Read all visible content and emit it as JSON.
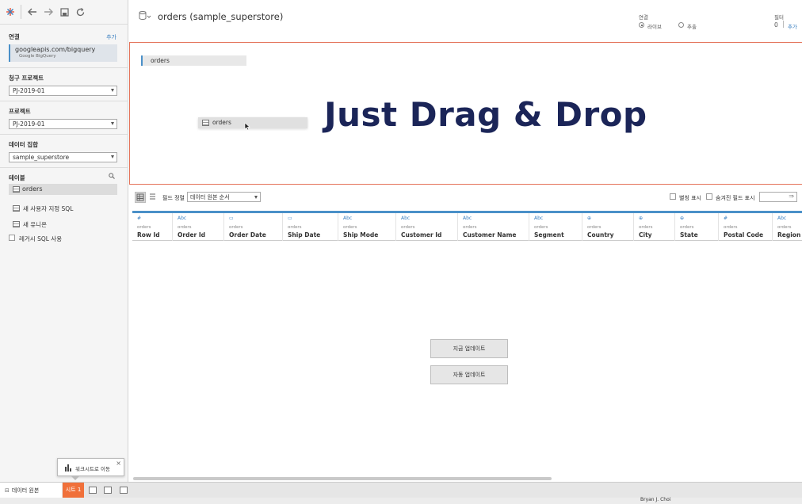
{
  "sidebar": {
    "connection_label": "연결",
    "connection_add": "추가",
    "connection_name": "googleapis.com/bigquery",
    "connection_type": "Google BigQuery",
    "billing_project_label": "청구 프로젝트",
    "billing_project_value": "PJ-2019-01",
    "project_label": "프로젝트",
    "project_value": "PJ-2019-01",
    "dataset_label": "데이터 집합",
    "dataset_value": "sample_superstore",
    "tables_label": "테이블",
    "table_item": "orders",
    "new_custom_sql": "새 사용자 지정 SQL",
    "new_union": "새 유니온",
    "legacy_sql": "레거시 SQL 사용"
  },
  "header": {
    "title": "orders (sample_superstore)",
    "connection_label": "연결",
    "live": "라이브",
    "extract": "추출",
    "filter_label": "필터",
    "filter_count": "0",
    "filter_add": "추가"
  },
  "canvas": {
    "table": "orders",
    "dragging_table": "orders",
    "overlay_text": "Just Drag & Drop"
  },
  "grid_toolbar": {
    "field_sort_label": "필드 정렬",
    "sort_value": "데이터 원본 순서",
    "show_alias": "별칭 표시",
    "show_hidden": "숨겨진 필드 표시"
  },
  "columns": [
    {
      "icon": "#",
      "table": "orders",
      "name": "Row Id"
    },
    {
      "icon": "Abc",
      "table": "orders",
      "name": "Order Id"
    },
    {
      "icon": "▭",
      "table": "orders",
      "name": "Order Date"
    },
    {
      "icon": "▭",
      "table": "orders",
      "name": "Ship Date"
    },
    {
      "icon": "Abc",
      "table": "orders",
      "name": "Ship Mode"
    },
    {
      "icon": "Abc",
      "table": "orders",
      "name": "Customer Id"
    },
    {
      "icon": "Abc",
      "table": "orders",
      "name": "Customer Name"
    },
    {
      "icon": "Abc",
      "table": "orders",
      "name": "Segment"
    },
    {
      "icon": "⊕",
      "table": "orders",
      "name": "Country"
    },
    {
      "icon": "⊕",
      "table": "orders",
      "name": "City"
    },
    {
      "icon": "⊕",
      "table": "orders",
      "name": "State"
    },
    {
      "icon": "#",
      "table": "orders",
      "name": "Postal Code"
    },
    {
      "icon": "Abc",
      "table": "orders",
      "name": "Region"
    }
  ],
  "buttons": {
    "update_now": "지금 업데이트",
    "auto_update": "자동 업데이트"
  },
  "tooltip": {
    "text": "워크시트로 이동",
    "close": "×"
  },
  "bottom": {
    "data_source_tab": "데이터 원본",
    "sheet_tab": "시트 1",
    "user": "Bryan J. Choi"
  },
  "colors": {
    "accent": "#4a90c8",
    "canvas_border": "#e4735a",
    "sheet_tab": "#f0703a",
    "overlay_text": "#1b2558"
  }
}
